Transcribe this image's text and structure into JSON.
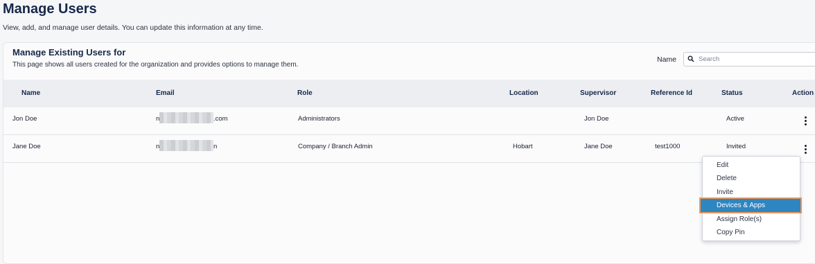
{
  "page": {
    "title": "Manage Users",
    "subtitle": "View, add, and manage user details. You can update this information at any time."
  },
  "card": {
    "title": "Manage Existing Users for",
    "description": "This page shows all users created for the organization and provides options to manage them.",
    "filter_label": "Name",
    "search_placeholder": "Search"
  },
  "table": {
    "columns": [
      "Name",
      "Email",
      "Role",
      "Location",
      "Supervisor",
      "Reference Id",
      "Status",
      "Action"
    ],
    "rows": [
      {
        "name": "Jon Doe",
        "email_prefix": "n",
        "email_suffix": ".com",
        "role": "Administrators",
        "location": "",
        "supervisor": "Jon Doe",
        "reference_id": "",
        "status": "Active"
      },
      {
        "name": "Jane Doe",
        "email_prefix": "n",
        "email_suffix": "n",
        "role": "Company / Branch Admin",
        "location": "Hobart",
        "supervisor": "Jane Doe",
        "reference_id": "test1000",
        "status": "Invited"
      }
    ]
  },
  "action_menu": {
    "items": [
      "Edit",
      "Delete",
      "Invite",
      "Devices & Apps",
      "Assign Role(s)",
      "Copy Pin"
    ],
    "highlighted": "Devices & Apps"
  },
  "colors": {
    "title": "#17284a",
    "highlight": "#2e86c1",
    "highlight_outline": "#e8975a"
  }
}
